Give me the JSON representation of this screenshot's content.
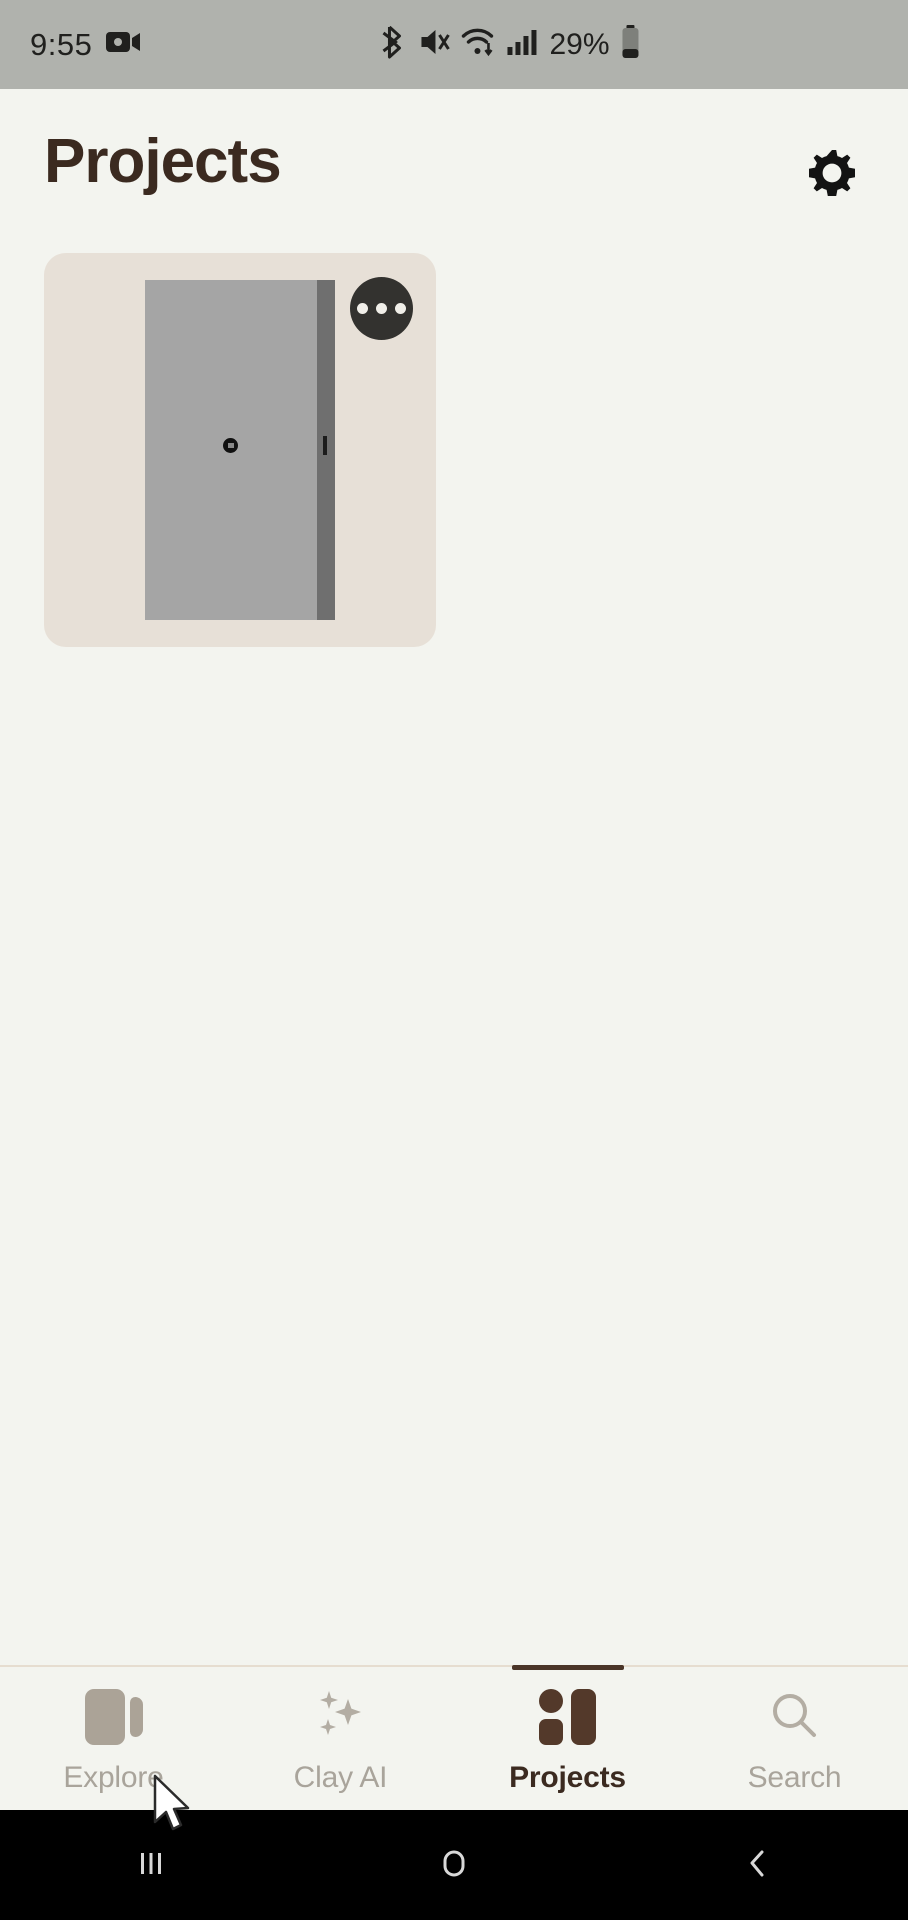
{
  "status_bar": {
    "time": "9:55",
    "battery_text": "29%",
    "icons": [
      "screen-recording-icon",
      "bluetooth-icon",
      "volume-mute-icon",
      "wifi-icon",
      "cellular-signal-icon",
      "battery-icon"
    ],
    "background_color": "#b0b2ad"
  },
  "header": {
    "title": "Projects",
    "settings_icon": "gear-icon",
    "title_color": "#3b2a20"
  },
  "main": {
    "projects": [
      {
        "thumbnail": "door-render-thumbnail",
        "menu_icon": "more-options-icon",
        "card_color": "#e7e0d7"
      }
    ]
  },
  "tab_bar": {
    "active_tab": "Projects",
    "accent_color": "#4a3528",
    "inactive_color": "#a9a49b",
    "tabs": [
      {
        "label": "Explore",
        "icon": "cards-icon",
        "active": false
      },
      {
        "label": "Clay AI",
        "icon": "sparkles-icon",
        "active": false
      },
      {
        "label": "Projects",
        "icon": "projects-grid-icon",
        "active": true
      },
      {
        "label": "Search",
        "icon": "search-icon",
        "active": false
      }
    ]
  },
  "android_nav": {
    "recents_icon": "recents-icon",
    "home_icon": "home-icon",
    "back_icon": "back-icon"
  },
  "theme": {
    "page_background": "#f3f4ef"
  }
}
